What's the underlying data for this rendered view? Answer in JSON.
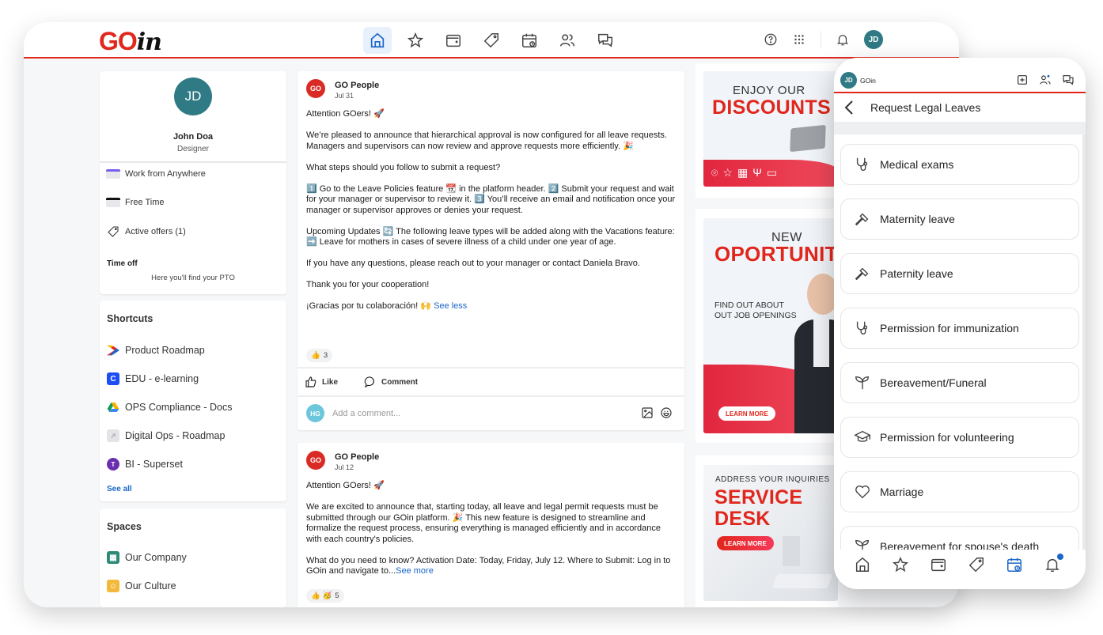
{
  "app": {
    "logo_go": "GO",
    "logo_in": "in",
    "nav": [
      {
        "name": "home",
        "icon": "home-icon",
        "active": true
      },
      {
        "name": "favorites",
        "icon": "star-icon",
        "active": false
      },
      {
        "name": "wallet",
        "icon": "wallet-icon",
        "active": false
      },
      {
        "name": "offers",
        "icon": "tag-icon",
        "active": false
      },
      {
        "name": "leave-calendar",
        "icon": "calendar-clock-icon",
        "active": false
      },
      {
        "name": "people",
        "icon": "people-icon",
        "active": false
      },
      {
        "name": "chat",
        "icon": "chat-icon",
        "active": false
      }
    ],
    "tools": {
      "help_icon": "help-icon",
      "apps_icon": "grid-icon",
      "notifications_icon": "bell-icon",
      "user_initials": "JD"
    },
    "colors": {
      "brand_red": "#e1261c",
      "teal_avatar": "#2f7a84",
      "link_blue": "#1a66c9"
    }
  },
  "profile": {
    "initials": "JD",
    "name": "John Doa",
    "role": "Designer",
    "links": [
      {
        "label": "Work from Anywhere",
        "icon": "purple-card-icon"
      },
      {
        "label": "Free Time",
        "icon": "black-card-icon"
      },
      {
        "label": "Active offers (1)",
        "icon": "tag-icon"
      }
    ],
    "timeoff_title": "Time off",
    "timeoff_sub": "Here you'll find your PTO"
  },
  "shortcuts": {
    "title": "Shortcuts",
    "items": [
      {
        "label": "Product Roadmap",
        "icon": "roadmap-logo-icon"
      },
      {
        "label": "EDU - e-learning",
        "icon": "c-logo-icon"
      },
      {
        "label": "OPS Compliance - Docs",
        "icon": "google-drive-icon"
      },
      {
        "label": "Digital Ops - Roadmap",
        "icon": "external-link-icon"
      },
      {
        "label": "BI - Superset",
        "icon": "superset-logo-icon"
      }
    ],
    "see_all": "See all"
  },
  "spaces": {
    "title": "Spaces",
    "items": [
      {
        "label": "Our Company",
        "icon": "building-icon"
      },
      {
        "label": "Our Culture",
        "icon": "smiley-icon"
      }
    ]
  },
  "posts": [
    {
      "author": "GO People",
      "avatar": "GO",
      "date": "Jul 31",
      "paragraphs": [
        "Attention GOers! 🚀",
        "We’re pleased to announce that hierarchical approval is now configured for all leave requests. Managers and supervisors can now review and approve requests more efficiently. 🎉",
        "What steps should you follow to submit a request?",
        "1️⃣ Go to the Leave Policies feature 📆 in the platform header. 2️⃣ Submit your request and wait for your manager or supervisor to review it. 3️⃣ You’ll receive an email and notification once your manager or supervisor approves or denies your request.",
        "Upcoming Updates 🔄 The following leave types will be added along with the Vacations feature:\n➡️ Leave for mothers in cases of severe illness of a child under one year of age.",
        "If you have any questions, please reach out to your manager or contact Daniela Bravo.",
        "Thank you for your cooperation!",
        "¡Gracias por tu colaboración! 🙌"
      ],
      "toggle_link": "See less",
      "reactions": "👍",
      "reaction_count": "3",
      "like_label": "Like",
      "comment_label": "Comment",
      "comment_avatar": "HG",
      "comment_placeholder": "Add a comment..."
    },
    {
      "author": "GO People",
      "avatar": "GO",
      "date": "Jul 12",
      "paragraphs": [
        "Attention GOers! 🚀",
        "We are excited to announce that, starting today, all leave and legal permit requests must be submitted through our GOin platform. 🎉 This new feature is designed to streamline and formalize the request process, ensuring everything is managed efficiently and in accordance with each country's policies.",
        "What do you need to know? Activation Date: Today, Friday, July 12. Where to Submit: Log in to GOin and navigate to..."
      ],
      "toggle_link": "See more",
      "reactions": "👍 🥳",
      "reaction_count": "5"
    }
  ],
  "banners": [
    {
      "small": "ENJOY OUR",
      "big": "DISCOUNTS",
      "icons": [
        "location-icon",
        "star-icon",
        "gift-icon",
        "restaurant-icon",
        "wallet-icon"
      ]
    },
    {
      "small": "NEW",
      "big": "OPORTUNITIES",
      "sub1": "FIND OUT ABOUT",
      "sub2": "OUT JOB OPENINGS",
      "cta": "LEARN MORE"
    },
    {
      "small": "ADDRESS YOUR INQUIRIES",
      "big1": "SERVICE",
      "big2": "DESK",
      "cta": "LEARN MORE"
    }
  ],
  "mobile": {
    "initials": "JD",
    "app_name": "GOin",
    "page_title": "Request Legal Leaves",
    "leaves": [
      {
        "label": "Medical exams",
        "icon": "stethoscope-icon"
      },
      {
        "label": "Maternity leave",
        "icon": "gavel-icon"
      },
      {
        "label": "Paternity leave",
        "icon": "gavel-icon"
      },
      {
        "label": "Permission for immunization",
        "icon": "stethoscope-icon"
      },
      {
        "label": "Bereavement/Funeral",
        "icon": "sprout-icon"
      },
      {
        "label": "Permission for volunteering",
        "icon": "graduation-cap-icon"
      },
      {
        "label": "Marriage",
        "icon": "heart-icon"
      },
      {
        "label": "Bereavement for spouse's death",
        "icon": "sprout-icon"
      }
    ],
    "bottom_nav": [
      "home",
      "favorites",
      "wallet",
      "offers",
      "leave-calendar",
      "notifications"
    ],
    "active_tab": "leave-calendar",
    "has_notification": true
  }
}
